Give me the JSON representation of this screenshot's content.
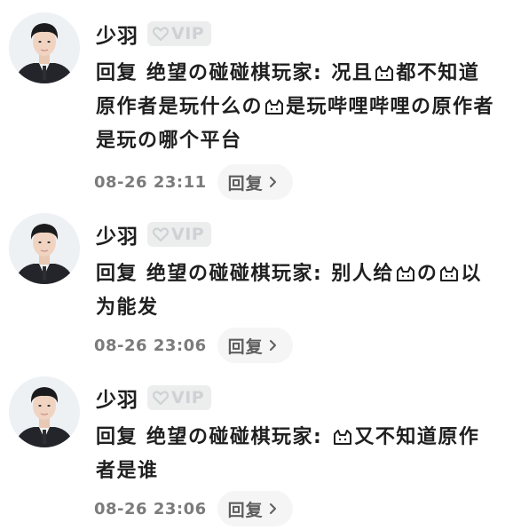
{
  "comments": [
    {
      "username": "少羽",
      "vip_label": "VIP",
      "reply_prefix": "回复",
      "reply_to": "绝望の碰碰棋玩家",
      "colon": ":",
      "text_a": "况且",
      "text_b": "都不知道原作者是玩什么の",
      "text_c": "是玩哔哩哔哩の原作者是玩の哪个平台",
      "time": "08-26 23:11",
      "reply_button": "回复"
    },
    {
      "username": "少羽",
      "vip_label": "VIP",
      "reply_prefix": "回复",
      "reply_to": "绝望の碰碰棋玩家",
      "colon": ":",
      "text_a": "别人给",
      "text_b": "の",
      "text_c": "以为能发",
      "time": "08-26 23:06",
      "reply_button": "回复"
    },
    {
      "username": "少羽",
      "vip_label": "VIP",
      "reply_prefix": "回复",
      "reply_to": "绝望の碰碰棋玩家",
      "colon": ":",
      "text_a": "",
      "text_b": "又不知道原作者是谁",
      "text_c": "",
      "time": "08-26 23:06",
      "reply_button": "回复"
    }
  ],
  "icons": {
    "vip": "heart-outline-icon",
    "inline_emoji": "cat-face-emoji-icon",
    "reply_arrow": "chevron-right-icon"
  },
  "colors": {
    "text": "#1f1f1f",
    "meta": "#7b7b7b",
    "vip_badge_bg": "#eceded",
    "vip_text": "#cfd2d4",
    "reply_bg": "#f5f5f5"
  }
}
